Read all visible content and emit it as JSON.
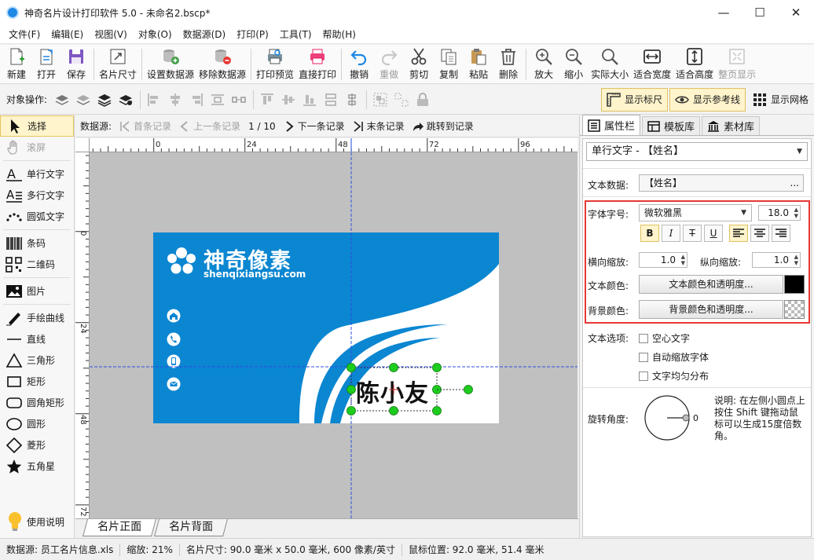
{
  "window": {
    "title": "神奇名片设计打印软件 5.0 - 未命名2.bscp*",
    "minimize_glyph": "—",
    "maximize_glyph": "☐",
    "close_glyph": "✕"
  },
  "menu": [
    "文件(F)",
    "编辑(E)",
    "视图(V)",
    "对象(O)",
    "数据源(D)",
    "打印(P)",
    "工具(T)",
    "帮助(H)"
  ],
  "toolbar": {
    "new": "新建",
    "open": "打开",
    "save": "保存",
    "card_size": "名片尺寸",
    "set_datasource": "设置数据源",
    "remove_datasource": "移除数据源",
    "print_preview": "打印预览",
    "direct_print": "直接打印",
    "undo": "撤销",
    "redo": "重做",
    "cut": "剪切",
    "copy": "复制",
    "paste": "粘贴",
    "delete": "删除",
    "zoom_in": "放大",
    "zoom_out": "缩小",
    "actual_size": "实际大小",
    "fit_width": "适合宽度",
    "fit_height": "适合高度",
    "fit_page": "整页显示"
  },
  "objbar": {
    "label": "对象操作:",
    "show_ruler": "显示标尺",
    "show_guides": "显示参考线",
    "show_grid": "显示网格"
  },
  "palette": {
    "select": "选择",
    "pan": "滚屏",
    "single_text": "单行文字",
    "multi_text": "多行文字",
    "arc_text": "圆弧文字",
    "barcode": "条码",
    "qrcode": "二维码",
    "image": "图片",
    "freehand": "手绘曲线",
    "line": "直线",
    "triangle": "三角形",
    "rectangle": "矩形",
    "rounded_rect": "圆角矩形",
    "ellipse": "圆形",
    "diamond": "菱形",
    "star": "五角星",
    "help": "使用说明"
  },
  "recnav": {
    "label": "数据源:",
    "first": "首条记录",
    "prev": "上一条记录",
    "position": "1 / 10",
    "next": "下一条记录",
    "last": "末条记录",
    "jump": "跳转到记录"
  },
  "rulers": {
    "top_labels": [
      "0",
      "24",
      "48",
      "72",
      "96"
    ],
    "left_labels": [
      "0",
      "24",
      "48",
      "72"
    ]
  },
  "card": {
    "brand_name": "神奇像素",
    "brand_url": "shenqixiangsu.com",
    "person_name": "陈小友",
    "blue": "#0b86d1"
  },
  "pagetabs": [
    "名片正面",
    "名片背面"
  ],
  "right_panel": {
    "tabs": [
      "属性栏",
      "模板库",
      "素材库"
    ],
    "object_selector": "单行文字 - 【姓名】",
    "text_data_label": "文本数据:",
    "text_data_value": "【姓名】",
    "text_data_btn": "...",
    "font_label": "字体字号:",
    "font_name": "微软雅黑",
    "font_size": "18.0",
    "bold": "B",
    "italic": "I",
    "strike": "T",
    "underline": "U",
    "hscale_label": "横向缩放:",
    "hscale_value": "1.0",
    "vscale_label": "纵向缩放:",
    "vscale_value": "1.0",
    "text_color_label": "文本颜色:",
    "text_color_btn": "文本颜色和透明度...",
    "bg_color_label": "背景颜色:",
    "bg_color_btn": "背景颜色和透明度...",
    "text_options_label": "文本选项:",
    "opt_hollow": "空心文字",
    "opt_autoscale": "自动缩放字体",
    "opt_distribute": "文字均匀分布",
    "rotation_label": "旋转角度:",
    "rotation_value": "0",
    "rotation_note": "说明: 在左侧小圆点上按住 Shift 键拖动鼠标可以生成15度倍数角。",
    "highlight_color": "#e53935",
    "text_color": "#000000"
  },
  "status": {
    "datasource": "数据源: 员工名片信息.xls",
    "zoom": "缩放: 21%",
    "card_size": "名片尺寸: 90.0 毫米 x 50.0 毫米, 600 像素/英寸",
    "mouse_pos": "鼠标位置: 92.0 毫米, 51.4 毫米"
  }
}
